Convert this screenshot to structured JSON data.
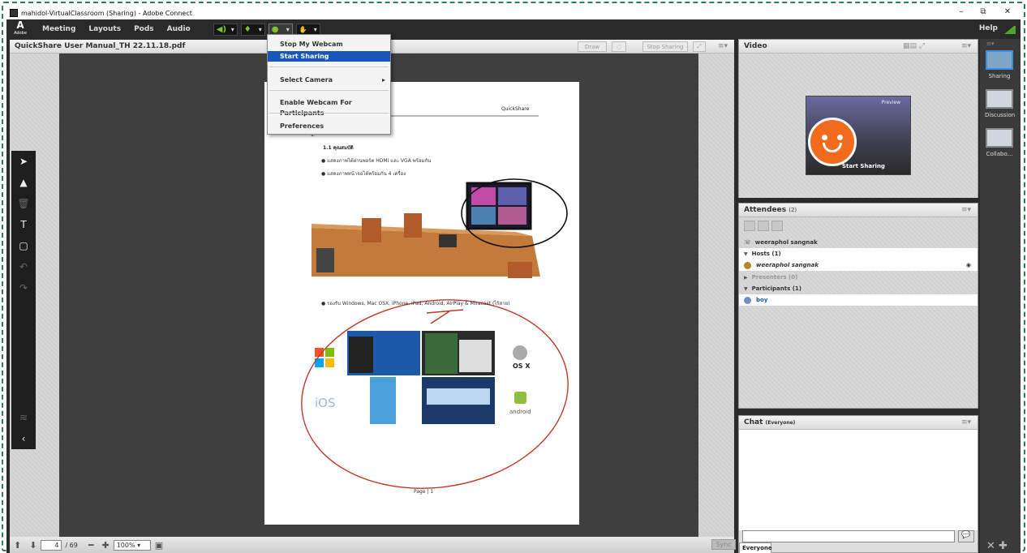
{
  "window": {
    "title": "mahidol-VirtualClassroom (Sharing) - Adobe Connect",
    "minimize": "–",
    "restore": "⧉",
    "close": "✕"
  },
  "menubar": {
    "logo": "Adobe",
    "items": [
      "Meeting",
      "Layouts",
      "Pods",
      "Audio"
    ],
    "help": "Help"
  },
  "dropdown": {
    "items": [
      "Stop My Webcam",
      "Start Sharing",
      "Select Camera",
      "Enable Webcam For Participants",
      "Preferences"
    ],
    "highlighted": "Start Sharing",
    "submenu_arrow": "▸"
  },
  "share_pod": {
    "title": "QuickShare User Manual_TH 22.11.18.pdf",
    "draw": "Draw",
    "stop_sharing": "Stop Sharing"
  },
  "document": {
    "header_right": "QuickShare",
    "heading": "1.1 คุณสมบัติ",
    "bullets": [
      "แสดงภาพได้ผ่านพอร์ต HDMI และ VGA พร้อมกัน",
      "แสดงภาพหน้าจอได้พร้อมกัน 4 เครื่อง",
      "รองรับ Windows, Mac OSX, iPhone, iPad, Android, AirPlay & Miracast (ไร้สาย)"
    ],
    "osx_label": "OS X",
    "ios_label": "iOS",
    "android_label": "android",
    "page_footer": "Page | 1"
  },
  "pager": {
    "current": "4",
    "total": "/ 69",
    "zoom": "100%",
    "sync": "Sync"
  },
  "video_pod": {
    "title": "Video",
    "preview": "Preview",
    "start_sharing": "Start Sharing"
  },
  "attendees": {
    "title": "Attendees",
    "count": "(2)",
    "me": "weeraphol sangnak",
    "hosts": "Hosts (1)",
    "host_name": "weeraphol sangnak",
    "presenters": "Presenters (0)",
    "participants": "Participants (1)",
    "participant_name": "boy"
  },
  "chat": {
    "title": "Chat",
    "scope": "(Everyone)",
    "tab": "Everyone"
  },
  "layouts": [
    "Sharing",
    "Discussion",
    "Collabo..."
  ]
}
